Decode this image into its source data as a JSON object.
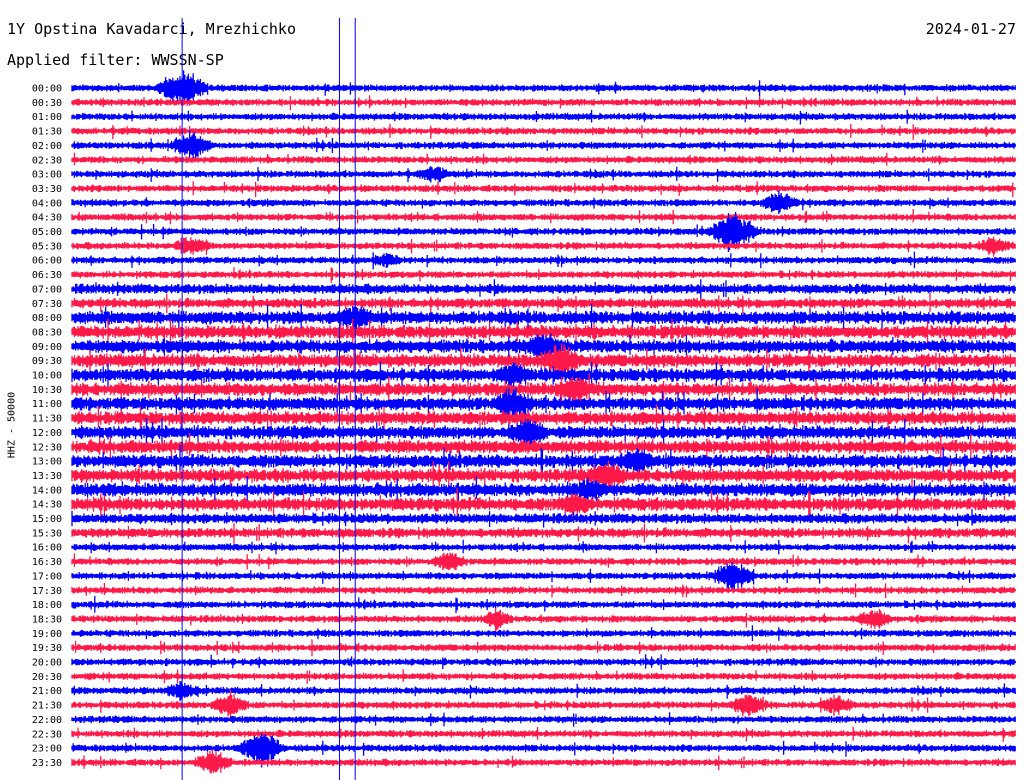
{
  "header": {
    "title": "1Y Opstina Kavadarci, Mrezhichko",
    "date": "2024-01-27",
    "filter": "Applied filter: WWSSN-SP"
  },
  "chart_data": {
    "type": "line",
    "title": "1Y Opstina Kavadarci, Mrezhichko",
    "ylabel": "HHZ - 50000",
    "row_labels": [
      "00:00",
      "00:30",
      "01:00",
      "01:30",
      "02:00",
      "02:30",
      "03:00",
      "03:30",
      "04:00",
      "04:30",
      "05:00",
      "05:30",
      "06:00",
      "06:30",
      "07:00",
      "07:30",
      "08:00",
      "08:30",
      "09:00",
      "09:30",
      "10:00",
      "10:30",
      "11:00",
      "11:30",
      "12:00",
      "12:30",
      "13:00",
      "13:30",
      "14:00",
      "14:30",
      "15:00",
      "15:30",
      "16:00",
      "16:30",
      "17:00",
      "17:30",
      "18:00",
      "18:30",
      "19:00",
      "19:30",
      "20:00",
      "20:30",
      "21:00",
      "21:30",
      "22:00",
      "22:30",
      "23:00",
      "23:30"
    ],
    "series_colors": [
      "#0000ff",
      "#ff1a4a"
    ],
    "minute_markers": [
      3.5,
      8.5,
      9.0
    ],
    "events": [
      {
        "row": 0,
        "minute": 3.5,
        "strength": 1.0
      },
      {
        "row": 4,
        "minute": 3.8,
        "strength": 0.7
      },
      {
        "row": 6,
        "minute": 11.5,
        "strength": 0.4
      },
      {
        "row": 8,
        "minute": 22.5,
        "strength": 0.6
      },
      {
        "row": 10,
        "minute": 21.0,
        "strength": 1.0
      },
      {
        "row": 11,
        "minute": 3.8,
        "strength": 0.5
      },
      {
        "row": 11,
        "minute": 29.3,
        "strength": 0.5
      },
      {
        "row": 12,
        "minute": 10.0,
        "strength": 0.3
      },
      {
        "row": 16,
        "minute": 9.0,
        "strength": 0.5
      },
      {
        "row": 18,
        "minute": 15.0,
        "strength": 0.6
      },
      {
        "row": 19,
        "minute": 15.5,
        "strength": 0.7
      },
      {
        "row": 20,
        "minute": 14.0,
        "strength": 0.5
      },
      {
        "row": 21,
        "minute": 16.0,
        "strength": 0.6
      },
      {
        "row": 22,
        "minute": 14.0,
        "strength": 0.7
      },
      {
        "row": 24,
        "minute": 14.5,
        "strength": 0.6
      },
      {
        "row": 26,
        "minute": 18.0,
        "strength": 0.5
      },
      {
        "row": 27,
        "minute": 17.0,
        "strength": 0.6
      },
      {
        "row": 28,
        "minute": 16.5,
        "strength": 0.5
      },
      {
        "row": 29,
        "minute": 16.0,
        "strength": 0.5
      },
      {
        "row": 33,
        "minute": 12.0,
        "strength": 0.5
      },
      {
        "row": 34,
        "minute": 21.0,
        "strength": 0.8
      },
      {
        "row": 37,
        "minute": 13.5,
        "strength": 0.4
      },
      {
        "row": 37,
        "minute": 25.5,
        "strength": 0.5
      },
      {
        "row": 42,
        "minute": 3.5,
        "strength": 0.5
      },
      {
        "row": 43,
        "minute": 5.0,
        "strength": 0.6
      },
      {
        "row": 43,
        "minute": 21.5,
        "strength": 0.6
      },
      {
        "row": 43,
        "minute": 24.3,
        "strength": 0.5
      },
      {
        "row": 46,
        "minute": 6.0,
        "strength": 0.9
      },
      {
        "row": 47,
        "minute": 4.5,
        "strength": 0.6
      }
    ],
    "x_range_minutes": [
      0,
      30
    ],
    "grid": false
  }
}
